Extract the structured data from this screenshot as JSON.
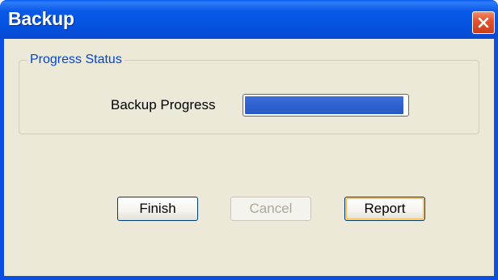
{
  "window": {
    "title": "Backup",
    "close_icon": "close-icon"
  },
  "progress_group": {
    "legend": "Progress Status",
    "label": "Backup Progress",
    "progress_fraction": 0.98
  },
  "buttons": {
    "finish": {
      "label": "Finish",
      "enabled": true
    },
    "cancel": {
      "label": "Cancel",
      "enabled": false
    },
    "report": {
      "label": "Report",
      "enabled": true,
      "focused": true
    }
  },
  "colors": {
    "titlebar": "#0553e0",
    "client_bg": "#ece9d8",
    "close_button": "#e1532f",
    "group_legend": "#0046d5",
    "progress_fill": "#2f62cf",
    "disabled_text": "#aca899"
  }
}
